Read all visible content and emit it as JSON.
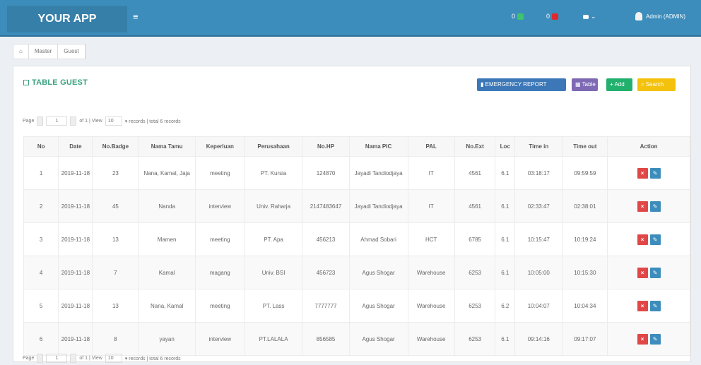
{
  "app": {
    "title": "YOUR APP"
  },
  "topbar": {
    "menu_glyph": "≡",
    "notif1": {
      "count": "0",
      "color": "#3ec46d"
    },
    "notif2": {
      "count": "0",
      "color": "#e0282d"
    },
    "user_name": "Admin (ADMIN)"
  },
  "breadcrumb": [
    "⌂",
    "Master",
    "Guest"
  ],
  "panel": {
    "title": "TABLE GUEST",
    "buttons": {
      "report": "EMERGENCY REPORT",
      "table": "Table",
      "add": "+ Add",
      "search": "Search"
    }
  },
  "pager": {
    "page_label": "Page",
    "page_value": "1",
    "of_label": "of 1 | View",
    "view_value": "10",
    "records_label": "▾ records | total 6 records"
  },
  "table": {
    "headers": [
      "No",
      "Date",
      "No.Badge",
      "Nama Tamu",
      "Keperluan",
      "Perusahaan",
      "No.HP",
      "Nama PIC",
      "PAL",
      "No.Ext",
      "Loc",
      "Time in",
      "Time out",
      "Action"
    ],
    "rows": [
      [
        "1",
        "2019-11-18",
        "23",
        "Nana, Kamal, Jaja",
        "meeting",
        "PT. Kursia",
        "124870",
        "Jayadi Tandiodjaya",
        "IT",
        "4561",
        "6.1",
        "03:18:17",
        "09:59:59"
      ],
      [
        "2",
        "2019-11-18",
        "45",
        "Nanda",
        "interview",
        "Univ. Raharja",
        "2147483647",
        "Jayadi Tandiodjaya",
        "IT",
        "4561",
        "6.1",
        "02:33:47",
        "02:38:01"
      ],
      [
        "3",
        "2019-11-18",
        "13",
        "Mamen",
        "meeting",
        "PT. Apa",
        "456213",
        "Ahmad Sobari",
        "HCT",
        "6785",
        "6.1",
        "10:15:47",
        "10:19:24"
      ],
      [
        "4",
        "2019-11-18",
        "7",
        "Kamal",
        "magang",
        "Univ. BSI",
        "456723",
        "Agus Shogar",
        "Warehouse",
        "6253",
        "6.1",
        "10:05:00",
        "10:15:30"
      ],
      [
        "5",
        "2019-11-18",
        "13",
        "Nana, Kamal",
        "meeting",
        "PT. Lass",
        "7777777",
        "Agus Shogar",
        "Warehouse",
        "6253",
        "6.2",
        "10:04:07",
        "10:04:34"
      ],
      [
        "6",
        "2019-11-18",
        "8",
        "yayan",
        "interview",
        "PT.LALALA",
        "856585",
        "Agus Shogar",
        "Warehouse",
        "6253",
        "6.1",
        "09:14:16",
        "09:17:07"
      ]
    ],
    "action": {
      "delete": "×",
      "edit": "✎"
    }
  },
  "footer_pager": {
    "page_label": "Page",
    "page_value": "1",
    "of_label": "of 1 | View",
    "view_value": "10",
    "records_label": "▾ records | total 6 records"
  }
}
